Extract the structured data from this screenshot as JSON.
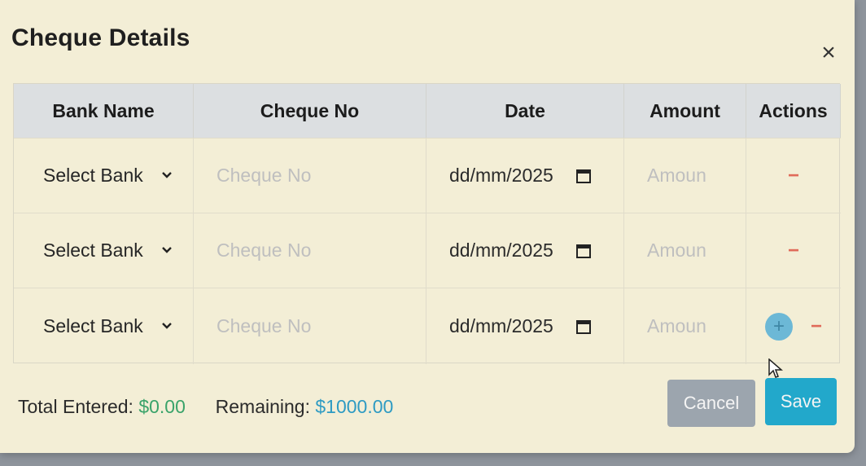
{
  "modal": {
    "title": "Cheque Details",
    "close_icon": "close-icon",
    "close_glyph": "×"
  },
  "table": {
    "headers": [
      "Bank Name",
      "Cheque No",
      "Date",
      "Amount",
      "Actions"
    ],
    "rows": [
      {
        "bank": "Select Bank",
        "cheque_placeholder": "Cheque No",
        "date": "dd/mm/2025",
        "amount_placeholder": "Amoun",
        "remove": "−"
      },
      {
        "bank": "Select Bank",
        "cheque_placeholder": "Cheque No",
        "date": "dd/mm/2025",
        "amount_placeholder": "Amoun",
        "remove": "−"
      },
      {
        "bank": "Select Bank",
        "cheque_placeholder": "Cheque No",
        "date": "dd/mm/2025",
        "amount_placeholder": "Amoun",
        "add": "+",
        "remove": "−"
      }
    ]
  },
  "footer": {
    "total_label": "Total Entered:",
    "total_value": "$0.00",
    "remaining_label": "Remaining:",
    "remaining_value": "$1000.00",
    "cancel_label": "Cancel",
    "save_label": "Save"
  },
  "icons": {
    "chevron": "chevron-down-icon",
    "calendar": "calendar-icon",
    "add": "plus-icon",
    "remove": "minus-icon",
    "pointer": "mouse-cursor-icon"
  },
  "colors": {
    "modal_bg": "#f3eed6",
    "header_bg": "#dcdfe1",
    "remove_red": "#e06b5a",
    "add_blue": "#6cb8d6",
    "save_blue": "#22a8cb",
    "cancel_gray": "#9ca5ae",
    "total_green": "#3aa36a",
    "remaining_blue": "#2e9bc3"
  }
}
